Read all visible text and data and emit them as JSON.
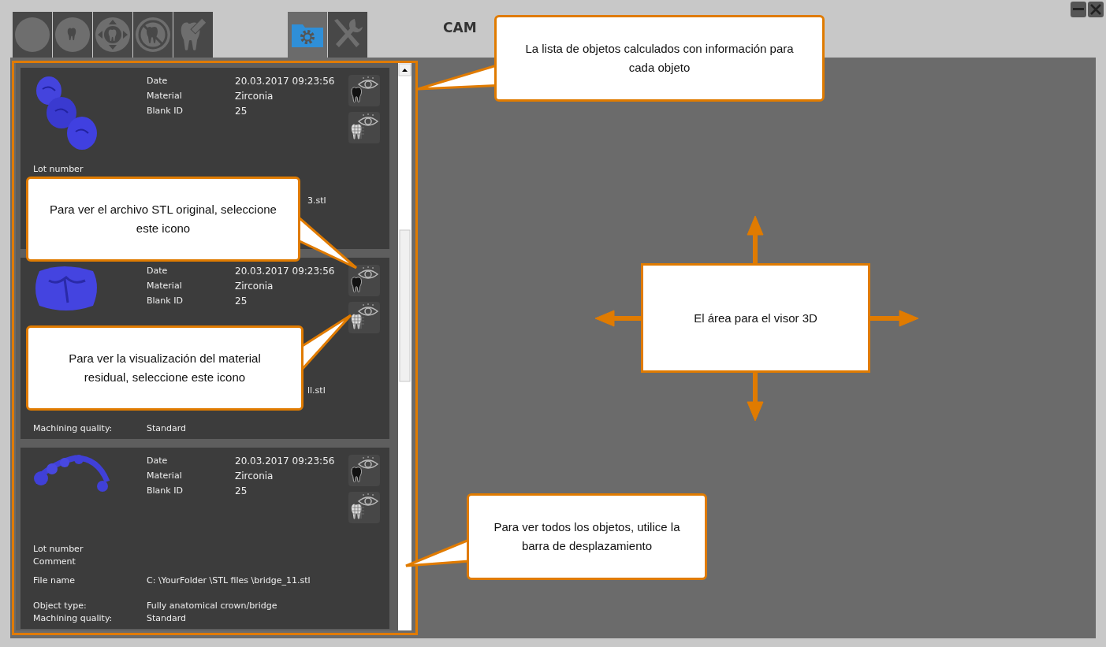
{
  "window": {
    "title": "CAM"
  },
  "toolbar": [
    {
      "kind": "circle",
      "selected": false
    },
    {
      "kind": "tooth-circle",
      "selected": false
    },
    {
      "kind": "move",
      "selected": false
    },
    {
      "kind": "no-tooth",
      "selected": false
    },
    {
      "kind": "tooth-edit",
      "selected": false
    },
    {
      "kind": "folder-gear",
      "selected": true
    },
    {
      "kind": "tools",
      "selected": false
    }
  ],
  "objects": [
    {
      "details": [
        {
          "label": "Date",
          "value": "20.03.2017 09:23:56"
        },
        {
          "label": "Material",
          "value": "Zirconia"
        },
        {
          "label": "Blank ID",
          "value": "25"
        }
      ],
      "fields": [
        {
          "kind": "lot",
          "label": "Lot number"
        },
        {
          "kind": "file",
          "value": "3.stl"
        }
      ]
    },
    {
      "details": [
        {
          "label": "Date",
          "value": "20.03.2017 09:23:56"
        },
        {
          "label": "Material",
          "value": "Zirconia"
        },
        {
          "label": "Blank ID",
          "value": "25"
        }
      ],
      "fields": [
        {
          "kind": "file",
          "value": "ll.stl"
        },
        {
          "kind": "quality",
          "label": "Machining quality:",
          "value": "Standard"
        }
      ]
    },
    {
      "details": [
        {
          "label": "Date",
          "value": "20.03.2017 09:23:56"
        },
        {
          "label": "Material",
          "value": "Zirconia"
        },
        {
          "label": "Blank ID",
          "value": "25"
        }
      ],
      "fields": [
        {
          "kind": "lot",
          "label": "Lot number"
        },
        {
          "kind": "comment",
          "label": "Comment"
        },
        {
          "kind": "file",
          "label": "File name",
          "value": "C: \\YourFolder \\STL files \\bridge_11.stl"
        },
        {
          "kind": "type",
          "label": "Object type:",
          "value": "Fully anatomical crown/bridge"
        },
        {
          "kind": "quality",
          "label": "Machining quality:",
          "value": "Standard"
        }
      ]
    }
  ],
  "callouts": [
    {
      "kind": "list",
      "text": "La lista de objetos calculados con información para cada objeto"
    },
    {
      "kind": "original",
      "text": "Para ver el archivo STL original, seleccione este icono"
    },
    {
      "kind": "residual",
      "text": "Para ver la visualización del material residual, seleccione este icono"
    },
    {
      "kind": "scroll",
      "text": "Para ver todos los objetos, utilice la barra de desplazamiento"
    },
    {
      "kind": "viewer",
      "text": "El área para el visor 3D"
    }
  ]
}
